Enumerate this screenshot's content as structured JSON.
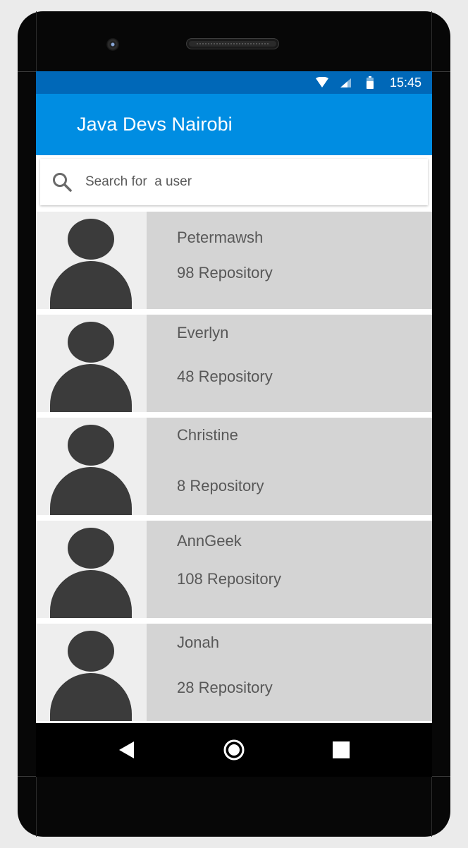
{
  "status_bar": {
    "time": "15:45",
    "icons": [
      "wifi-icon",
      "signal-icon",
      "battery-icon"
    ]
  },
  "app_bar": {
    "title": "Java Devs Nairobi"
  },
  "search": {
    "placeholder": "Search for  a user",
    "icon": "search-icon"
  },
  "users": [
    {
      "name": "Petermawsh",
      "repos": "98 Repository"
    },
    {
      "name": "Everlyn",
      "repos": "48 Repository"
    },
    {
      "name": "Christine",
      "repos": "8 Repository"
    },
    {
      "name": "AnnGeek",
      "repos": "108 Repository"
    },
    {
      "name": "Jonah",
      "repos": "28 Repository"
    }
  ],
  "nav_bar": {
    "icons": [
      "back-icon",
      "home-icon",
      "recents-icon"
    ]
  },
  "colors": {
    "status_bar": "#0068b8",
    "app_bar": "#008de2",
    "row_bg": "#d4d4d4",
    "avatar_bg": "#eeeeee",
    "avatar_fg": "#3b3b3b"
  }
}
